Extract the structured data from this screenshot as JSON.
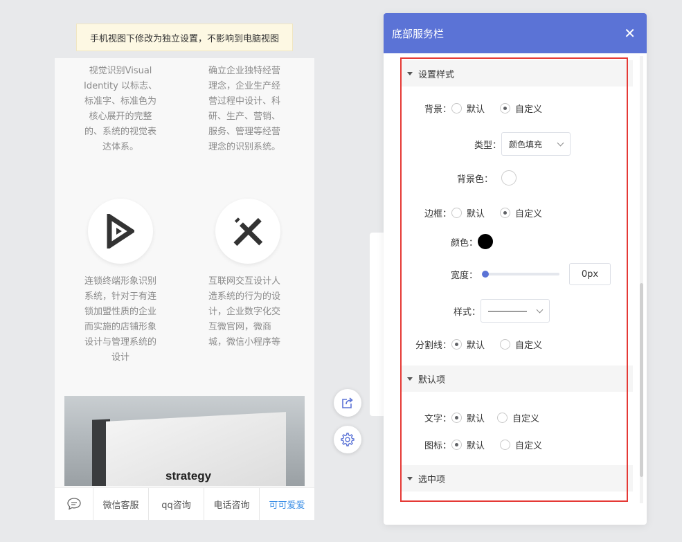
{
  "notice": {
    "text": "手机视图下修改为独立设置，不影响到电脑视图"
  },
  "phone": {
    "blocks": [
      {
        "lines": [
          "视觉识别Visual",
          "Identity 以标志、",
          "标准字、标准色为",
          "核心展开的完整",
          "的、系统的视觉表",
          "达体系。"
        ]
      },
      {
        "lines": [
          "确立企业独特经营",
          "理念，企业生产经",
          "营过程中设计、科",
          "研、生产、营销、",
          "服务、管理等经营",
          "理念的识别系统。"
        ]
      },
      {
        "lines": [
          "连锁终端形象识别",
          "系统，针对于有连",
          "锁加盟性质的企业",
          "而实施的店铺形象",
          "设计与管理系统的",
          "设计"
        ]
      },
      {
        "lines": [
          "互联网交互设计人",
          "造系统的行为的设",
          "计，企业数字化交",
          "互微官网，微商",
          "城，微信小程序等"
        ]
      }
    ],
    "icons": [
      "play-triangle-icon",
      "design-tools-icon"
    ],
    "photo_text": "strategy",
    "bottom_bar": {
      "chat_icon": "chat-bubble-icon",
      "items": [
        "微信客服",
        "qq咨询",
        "电话咨询",
        "可可爱爱"
      ]
    }
  },
  "fabs": [
    "share-icon",
    "settings-gear-icon"
  ],
  "panel": {
    "title": "底部服务栏",
    "close_icon": "close-icon",
    "sections": {
      "style": {
        "label": "设置样式"
      },
      "default": {
        "label": "默认项"
      },
      "selected": {
        "label": "选中项"
      }
    },
    "background": {
      "label": "背景：",
      "options": [
        "默认",
        "自定义"
      ],
      "selected": "自定义",
      "type_label": "类型：",
      "type_value": "颜色填充",
      "color_label": "背景色：",
      "color": "#ffffff"
    },
    "border": {
      "label": "边框：",
      "options": [
        "默认",
        "自定义"
      ],
      "selected": "自定义",
      "color_label": "颜色：",
      "color": "#000000",
      "width_label": "宽度：",
      "width_value": "0px",
      "style_label": "样式："
    },
    "divider": {
      "label": "分割线：",
      "options": [
        "默认",
        "自定义"
      ],
      "selected": "默认"
    },
    "text": {
      "label": "文字：",
      "options": [
        "默认",
        "自定义"
      ],
      "selected": "默认"
    },
    "icon": {
      "label": "图标：",
      "options": [
        "默认",
        "自定义"
      ],
      "selected": "默认"
    }
  },
  "colors": {
    "header": "#5b73d6",
    "highlight_frame": "#e53935",
    "link": "#3a8ee6"
  }
}
